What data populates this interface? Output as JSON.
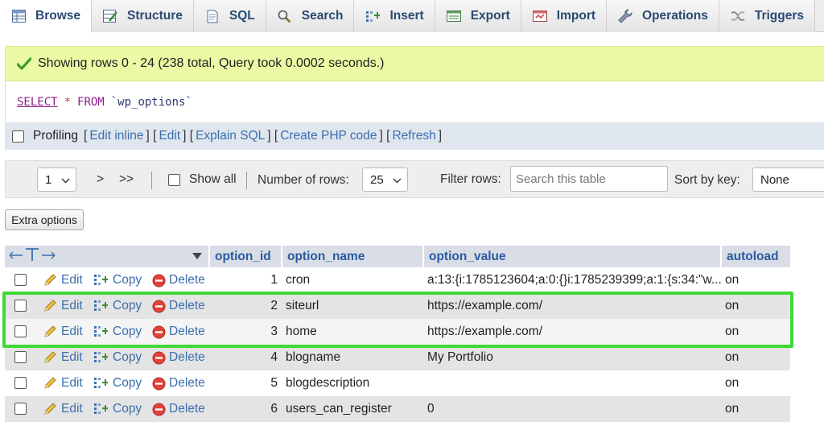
{
  "tabs": [
    {
      "label": "Browse",
      "icon": "browse-icon",
      "active": true
    },
    {
      "label": "Structure",
      "icon": "structure-icon"
    },
    {
      "label": "SQL",
      "icon": "sql-icon"
    },
    {
      "label": "Search",
      "icon": "search-icon"
    },
    {
      "label": "Insert",
      "icon": "insert-icon"
    },
    {
      "label": "Export",
      "icon": "export-icon"
    },
    {
      "label": "Import",
      "icon": "import-icon"
    },
    {
      "label": "Operations",
      "icon": "wrench-icon"
    },
    {
      "label": "Triggers",
      "icon": "triggers-icon"
    }
  ],
  "message": {
    "text": "Showing rows 0 - 24 (238 total, Query took 0.0002 seconds.)"
  },
  "sql": {
    "select": "SELECT",
    "star": "*",
    "from": "FROM",
    "table": "`wp_options`"
  },
  "profiling": {
    "label": "Profiling",
    "edit_inline": "Edit inline",
    "edit": "Edit",
    "explain": "Explain SQL",
    "create_php": "Create PHP code",
    "refresh": "Refresh"
  },
  "nav": {
    "page": "1",
    "next": ">",
    "last": ">>",
    "show_all": "Show all",
    "rows_label": "Number of rows:",
    "rows_value": "25",
    "filter_label": "Filter rows:",
    "filter_placeholder": "Search this table",
    "sort_label": "Sort by key:",
    "sort_value": "None"
  },
  "extra_options": "Extra options",
  "table": {
    "columns": [
      "option_id",
      "option_name",
      "option_value",
      "autoload"
    ],
    "actions": {
      "edit": "Edit",
      "copy": "Copy",
      "delete": "Delete"
    },
    "rows": [
      {
        "id": "1",
        "name": "cron",
        "value": "a:13:{i:1785123604;a:0:{}i:1785239399;a:1:{s:34:\"w...",
        "autoload": "on"
      },
      {
        "id": "2",
        "name": "siteurl",
        "value": "https://example.com/",
        "autoload": "on"
      },
      {
        "id": "3",
        "name": "home",
        "value": "https://example.com/",
        "autoload": "on"
      },
      {
        "id": "4",
        "name": "blogname",
        "value": "My Portfolio",
        "autoload": "on"
      },
      {
        "id": "5",
        "name": "blogdescription",
        "value": "",
        "autoload": "on"
      },
      {
        "id": "6",
        "name": "users_can_register",
        "value": "0",
        "autoload": "on"
      }
    ]
  },
  "colors": {
    "accent": "#3a6fae",
    "success_bg": "#ebf8a4",
    "highlight": "#3fd837",
    "delete_red": "#d9302c"
  }
}
